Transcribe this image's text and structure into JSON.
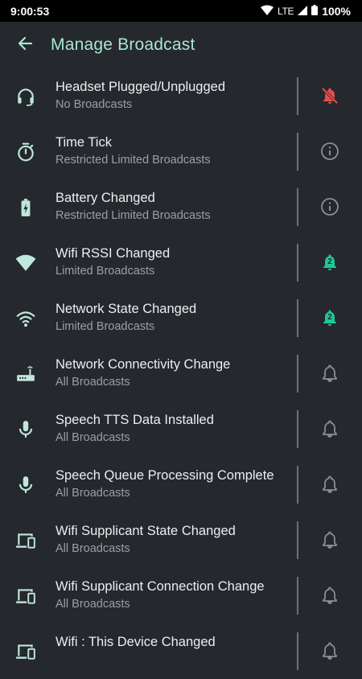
{
  "status": {
    "time": "9:00:53",
    "network": "LTE",
    "battery": "100%"
  },
  "header": {
    "title": "Manage Broadcast"
  },
  "colors": {
    "accent": "#a8e6cf",
    "icon": "#bfe7dc",
    "alert": "#e84c4c",
    "count": "#1ec79a",
    "muted": "#8a8f94"
  },
  "items": [
    {
      "title": "Headset Plugged/Unplugged",
      "subtitle": "No Broadcasts",
      "icon": "headset-icon",
      "action": "bell-off-icon"
    },
    {
      "title": "Time Tick",
      "subtitle": "Restricted Limited Broadcasts",
      "icon": "timer-icon",
      "action": "info-icon"
    },
    {
      "title": "Battery Changed",
      "subtitle": "Restricted Limited Broadcasts",
      "icon": "battery-charging-icon",
      "action": "info-icon"
    },
    {
      "title": "Wifi RSSI Changed",
      "subtitle": "Limited Broadcasts",
      "icon": "wifi-signal-icon",
      "action": "bell-count-icon",
      "count": "2"
    },
    {
      "title": "Network State Changed",
      "subtitle": "Limited Broadcasts",
      "icon": "wifi-icon",
      "action": "bell-count-icon",
      "count": "2"
    },
    {
      "title": "Network Connectivity Change",
      "subtitle": "All Broadcasts",
      "icon": "router-icon",
      "action": "bell-icon"
    },
    {
      "title": "Speech TTS Data Installed",
      "subtitle": "All Broadcasts",
      "icon": "mic-icon",
      "action": "bell-icon"
    },
    {
      "title": "Speech Queue Processing Complete",
      "subtitle": "All Broadcasts",
      "icon": "mic-icon",
      "action": "bell-icon"
    },
    {
      "title": "Wifi Supplicant State Changed",
      "subtitle": "All Broadcasts",
      "icon": "devices-icon",
      "action": "bell-icon"
    },
    {
      "title": "Wifi Supplicant Connection Change",
      "subtitle": "All Broadcasts",
      "icon": "devices-icon",
      "action": "bell-icon"
    },
    {
      "title": "Wifi : This Device Changed",
      "subtitle": "",
      "icon": "devices-icon",
      "action": "bell-icon"
    }
  ]
}
